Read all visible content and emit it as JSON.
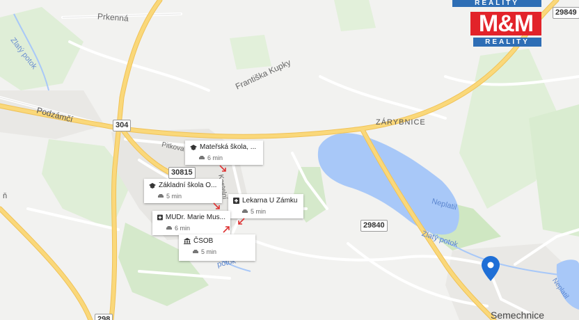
{
  "map": {
    "place_labels": {
      "prkenna": "Prkenná",
      "zlaty_potok_nw": "Zlatý potok",
      "frantiska_kupky": "Františka Kupky",
      "podzamci": "Podzámčí",
      "pitkova": "Pitkova",
      "zarybnice": "ZÁRYBNICE",
      "neplatil": "Neplatil",
      "zlaty_potok_se": "Zlatý potok",
      "potok_center": "potok",
      "kostel_street": "Kostelní",
      "semechnice": "Semechnice",
      "neplatil_right": "Neplatil",
      "left_edge": "ň"
    },
    "road_numbers": {
      "r304": "304",
      "r30815": "30815",
      "r29840": "29840",
      "r29849": "29849",
      "r298": "298"
    },
    "colors": {
      "background": "#f2f2f0",
      "water": "#a8c8f8",
      "park": "#cfe7c2",
      "road_major": "#fad87a",
      "road_minor": "#ffffff",
      "pin": "#1f6fd6"
    }
  },
  "pois": [
    {
      "icon": "school-icon",
      "name": "Mateřská škola, ...",
      "time": "6 min"
    },
    {
      "icon": "school-icon",
      "name": "Základní škola O...",
      "time": "5 min"
    },
    {
      "icon": "pharmacy-icon",
      "name": "Lekarna U Zámku",
      "time": "5 min"
    },
    {
      "icon": "medical-icon",
      "name": "MUDr. Marie Mus...",
      "time": "6 min"
    },
    {
      "icon": "bank-icon",
      "name": "ČSOB",
      "time": "5 min"
    }
  ],
  "logo": {
    "top_text": "REALITY",
    "brand": "M&M",
    "bottom_text": "REALITY",
    "colors": {
      "red": "#e2232a",
      "blue": "#2e6eb5"
    }
  }
}
